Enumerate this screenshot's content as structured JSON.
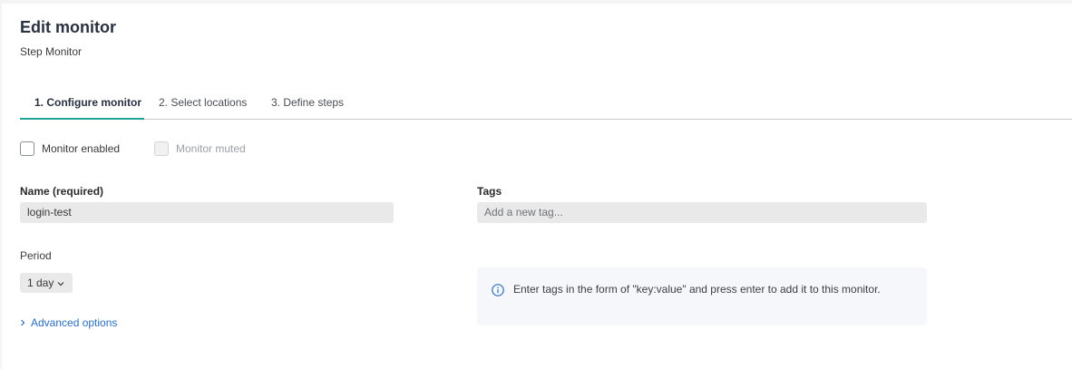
{
  "header": {
    "title": "Edit monitor",
    "subtitle": "Step Monitor"
  },
  "tabs": [
    {
      "label": "1. Configure monitor",
      "active": true
    },
    {
      "label": "2. Select locations",
      "active": false
    },
    {
      "label": "3. Define steps",
      "active": false
    }
  ],
  "checkboxes": {
    "enabled_label": "Monitor enabled",
    "enabled_checked": false,
    "muted_label": "Monitor muted",
    "muted_disabled": true
  },
  "form": {
    "name_label": "Name (required)",
    "name_value": "login-test",
    "tags_label": "Tags",
    "tags_placeholder": "Add a new tag...",
    "period_label": "Period",
    "period_value": "1 day",
    "advanced_label": "Advanced options"
  },
  "info": {
    "text": "Enter tags in the form of \"key:value\" and press enter to add it to this monitor.",
    "icon": "info-icon"
  },
  "colors": {
    "accent": "#1ea593",
    "link": "#2a6ebd"
  }
}
